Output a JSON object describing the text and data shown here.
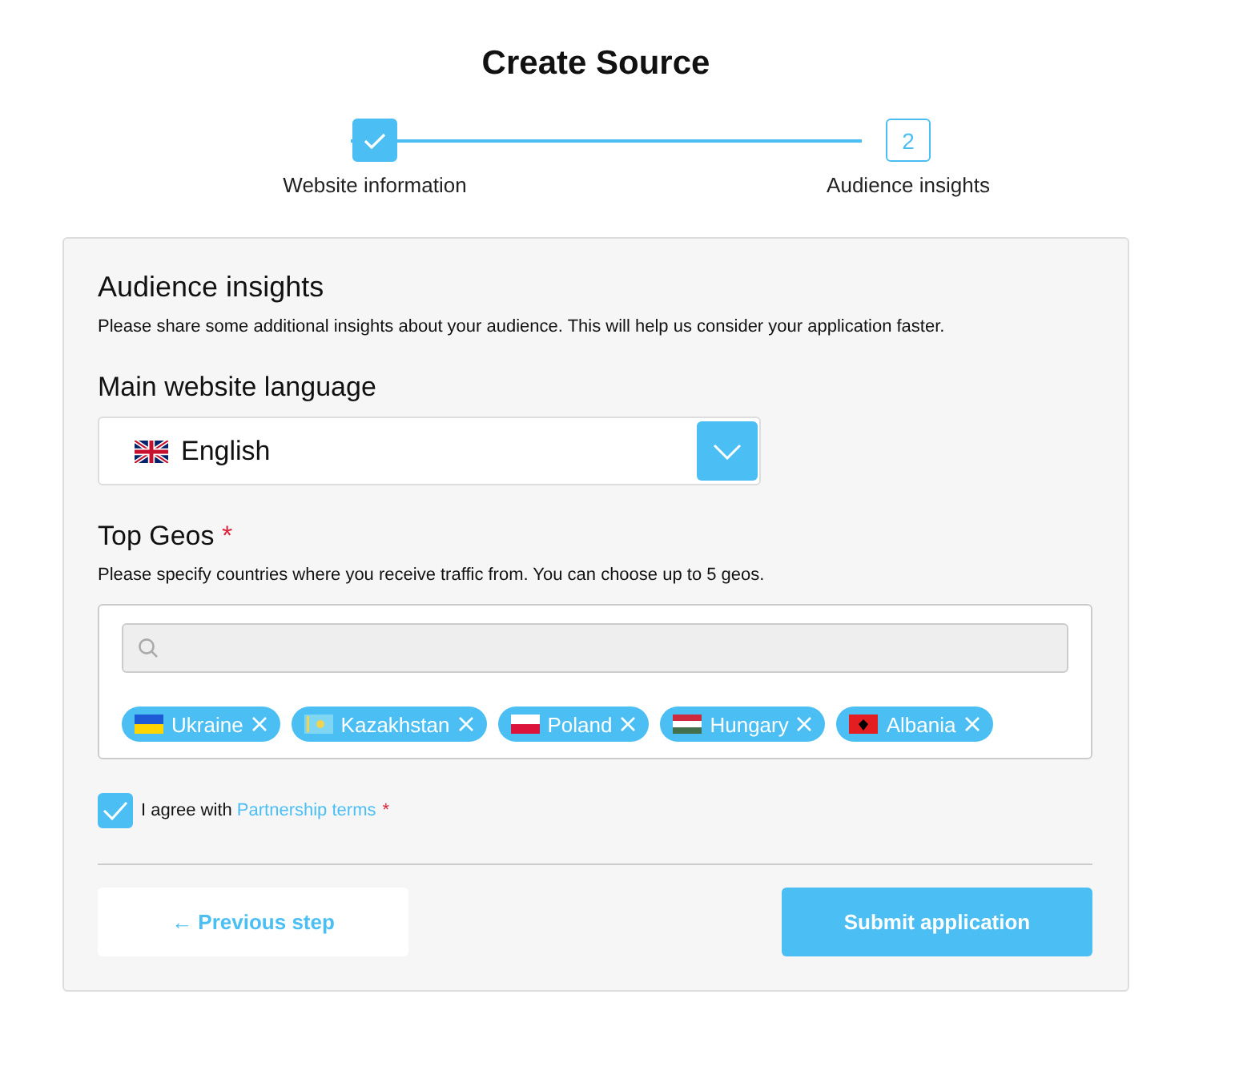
{
  "title": "Create Source",
  "steps": [
    {
      "label": "Website information",
      "completed": true
    },
    {
      "label": "Audience insights",
      "completed": false,
      "number": "2"
    }
  ],
  "section": {
    "heading": "Audience insights",
    "description": "Please share some additional insights about your audience. This will help us consider your application faster."
  },
  "language": {
    "label": "Main website language",
    "value": "English"
  },
  "geos": {
    "label": "Top Geos",
    "required_mark": "*",
    "description": "Please specify countries where you receive traffic from. You can choose up to 5 geos.",
    "tags": [
      {
        "label": "Ukraine"
      },
      {
        "label": "Kazakhstan"
      },
      {
        "label": "Poland"
      },
      {
        "label": "Hungary"
      },
      {
        "label": "Albania"
      }
    ]
  },
  "agreement": {
    "checked": true,
    "text": "I agree with",
    "link": "Partnership terms",
    "required_mark": "*"
  },
  "buttons": {
    "back": "← Previous step",
    "submit": "Submit application"
  }
}
